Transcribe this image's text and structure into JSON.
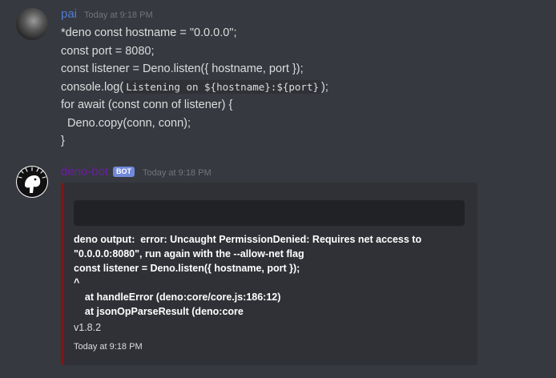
{
  "messages": {
    "pai": {
      "username": "pai",
      "timestamp": "Today at 9:18 PM",
      "lines": [
        "*deno const hostname = \"0.0.0.0\";",
        "const port = 8080;",
        "const listener = Deno.listen({ hostname, port });",
        "for await (const conn of listener) {",
        "  Deno.copy(conn, conn);",
        "}"
      ],
      "console_line": {
        "prefix": "console.log(",
        "code": "Listening on ${hostname}:${port}",
        "suffix": ");"
      }
    },
    "bot": {
      "username": "deno-bot",
      "badge": "BOT",
      "timestamp": "Today at 9:18 PM",
      "embed": {
        "accent_color": "#831515",
        "body_lines": [
          "deno output:  error: Uncaught PermissionDenied: Requires net access to",
          "\"0.0.0.0:8080\", run again with the --allow-net flag",
          "const listener = Deno.listen({ hostname, port });",
          "^",
          "    at handleError (deno:core/core.js:186:12)",
          "    at jsonOpParseResult (deno:core"
        ],
        "version": "v1.8.2",
        "footer_timestamp": "Today at 9:18 PM"
      }
    }
  },
  "colors": {
    "background": "#36393f",
    "embed_background": "#2f3136",
    "codeblock_background": "#202225",
    "pai_name": "#4f7bd6",
    "bot_name": "#6b1fa1",
    "bot_badge": "#7289da"
  }
}
